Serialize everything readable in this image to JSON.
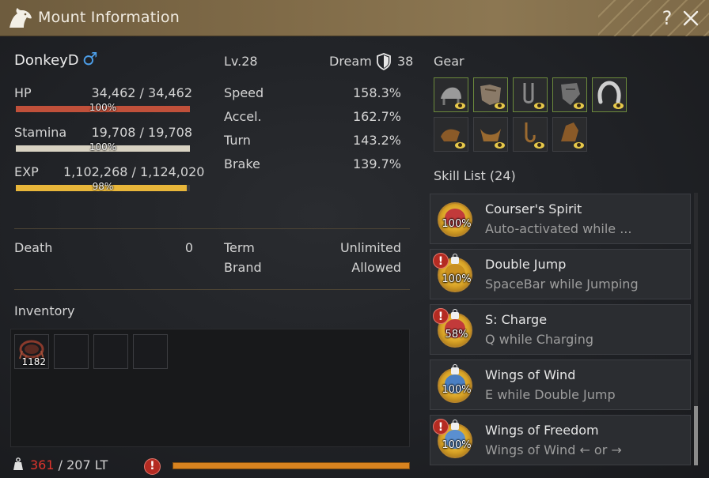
{
  "window": {
    "title": "Mount Information",
    "help_label": "?"
  },
  "mount": {
    "name": "DonkeyD",
    "gender_symbol": "♂",
    "level": "Lv.28",
    "dream_label": "Dream",
    "dream_value": "38"
  },
  "vitals": {
    "hp": {
      "label": "HP",
      "value": "34,462 / 34,462",
      "pct_label": "100%",
      "fraction": 1.0,
      "color": "#c0503a"
    },
    "stamina": {
      "label": "Stamina",
      "value": "19,708 / 19,708",
      "pct_label": "100%",
      "fraction": 1.0,
      "color": "#d8d2c2"
    },
    "exp": {
      "label": "EXP",
      "value": "1,102,268 / 1,124,020",
      "pct_label": "98%",
      "fraction": 0.98,
      "color": "#e8b63a"
    }
  },
  "stats": [
    {
      "label": "Speed",
      "value": "158.3%"
    },
    {
      "label": "Accel.",
      "value": "162.7%"
    },
    {
      "label": "Turn",
      "value": "143.2%"
    },
    {
      "label": "Brake",
      "value": "139.7%"
    }
  ],
  "info": {
    "death_label": "Death",
    "death_value": "0",
    "term_label": "Term",
    "term_value": "Unlimited",
    "brand_label": "Brand",
    "brand_value": "Allowed"
  },
  "gear": {
    "label": "Gear",
    "row1": [
      "saddle-icon",
      "barding-icon",
      "stirrups-icon",
      "champron-icon",
      "horseshoe-icon"
    ],
    "row2": [
      "outfit-saddle-icon",
      "outfit-armor-icon",
      "outfit-stirrups-icon",
      "outfit-head-icon"
    ]
  },
  "inventory": {
    "label": "Inventory",
    "items": [
      {
        "icon": "feed-icon",
        "count": "1182"
      },
      null,
      null,
      null
    ],
    "weight_current": "361",
    "weight_sep": " / ",
    "weight_max": "207 LT",
    "weight_fraction": 1.0
  },
  "skills": {
    "header": "Skill List (24)",
    "items": [
      {
        "name": "Courser's Spirit",
        "desc": "Auto-activated while ...",
        "pct": "100%",
        "locked": false,
        "warning": false,
        "color": "#c23a3a"
      },
      {
        "name": "Double Jump",
        "desc": "SpaceBar while Jumping",
        "pct": "100%",
        "locked": true,
        "warning": true,
        "color": "#c9901f"
      },
      {
        "name": "S: Charge",
        "desc": "Q while Charging",
        "pct": "58%",
        "locked": true,
        "warning": true,
        "color": "#c23a3a"
      },
      {
        "name": "Wings of Wind",
        "desc": "E while Double Jump",
        "pct": "100%",
        "locked": true,
        "warning": false,
        "color": "#4a7fc2"
      },
      {
        "name": "Wings of Freedom",
        "desc": "Wings of Wind ← or →",
        "pct": "100%",
        "locked": true,
        "warning": true,
        "color": "#5a8fd0"
      }
    ]
  },
  "colors": {
    "accent_gold": "#8c7752",
    "gear_border": "#6c8a3c",
    "warning": "#b42b22",
    "weight_over": "#e0342c"
  }
}
